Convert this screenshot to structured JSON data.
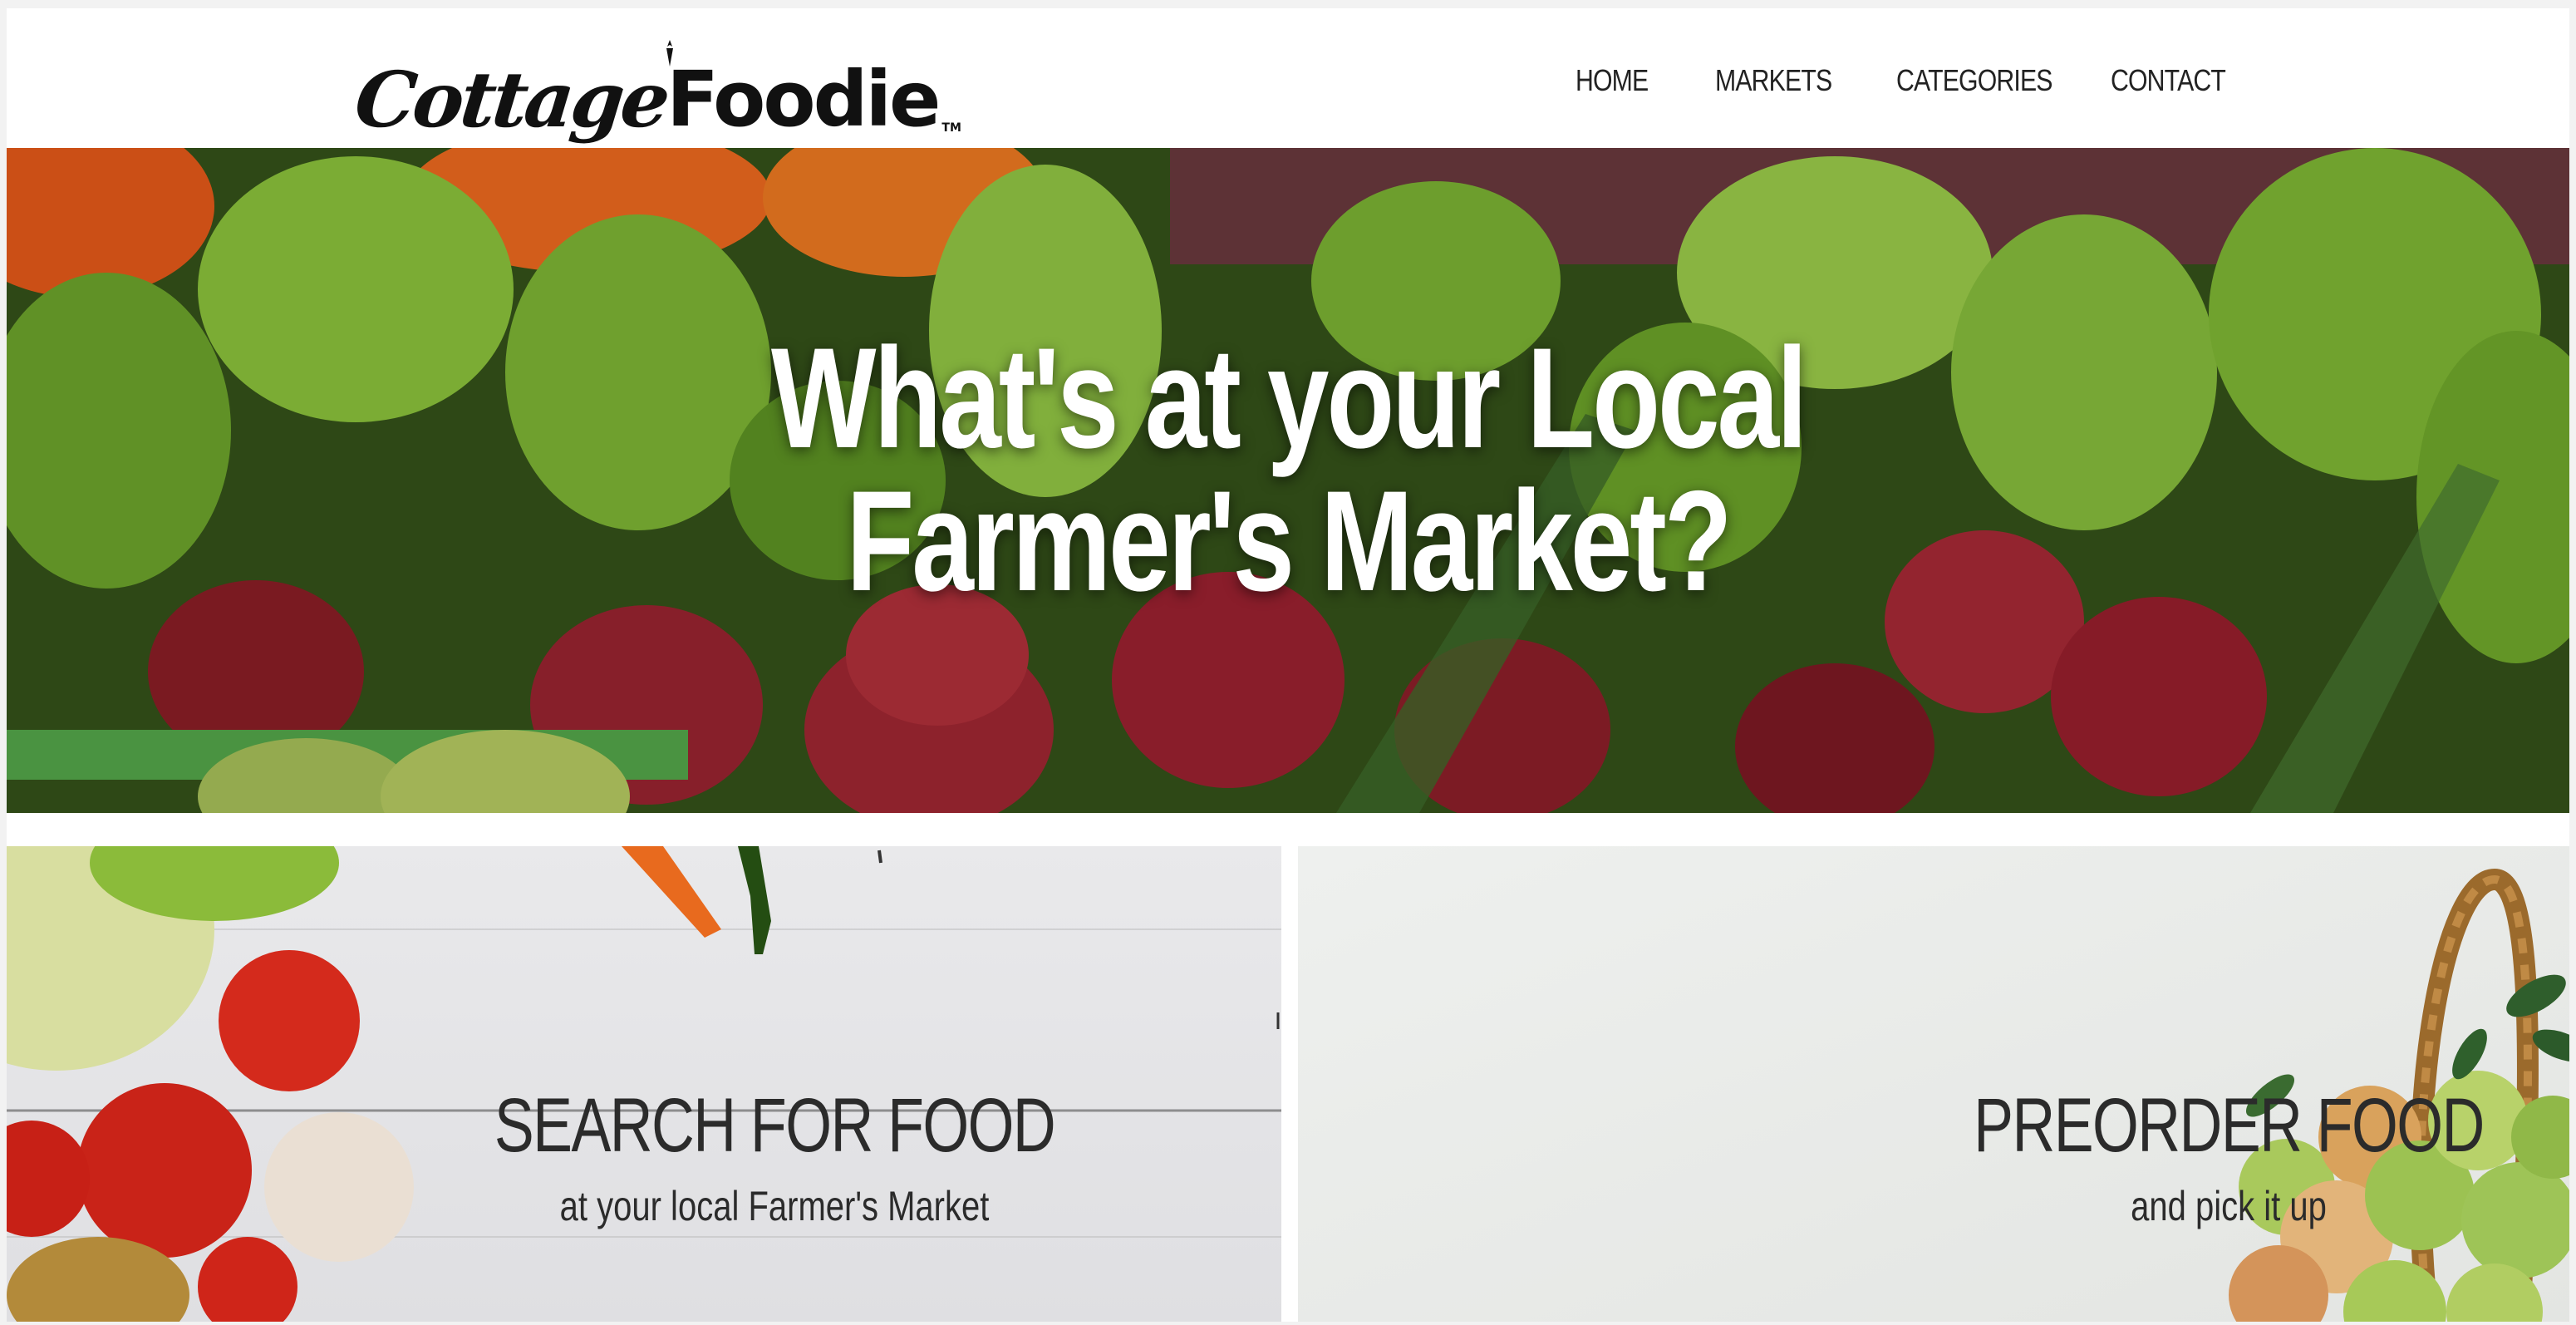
{
  "header": {
    "logo": {
      "text_part1": "Cottage",
      "text_part2": "Foodie",
      "trademark": "TM"
    },
    "nav": [
      {
        "label": "HOME"
      },
      {
        "label": "MARKETS"
      },
      {
        "label": "CATEGORIES"
      },
      {
        "label": "CONTACT"
      }
    ]
  },
  "hero": {
    "title_line1": "What's at your Local",
    "title_line2": "Farmer's Market?"
  },
  "cards": {
    "search": {
      "title": "SEARCH FOR FOOD",
      "subtitle": "at your local Farmer's Market"
    },
    "preorder": {
      "title": "PREORDER FOOD",
      "subtitle": "and pick it up"
    }
  },
  "colors": {
    "text_dark": "#2b2b2b",
    "hero_text": "#ffffff",
    "pepper_green": "#7cb72e",
    "potato_red": "#8c1d26",
    "pepper_orange": "#e8541c"
  }
}
